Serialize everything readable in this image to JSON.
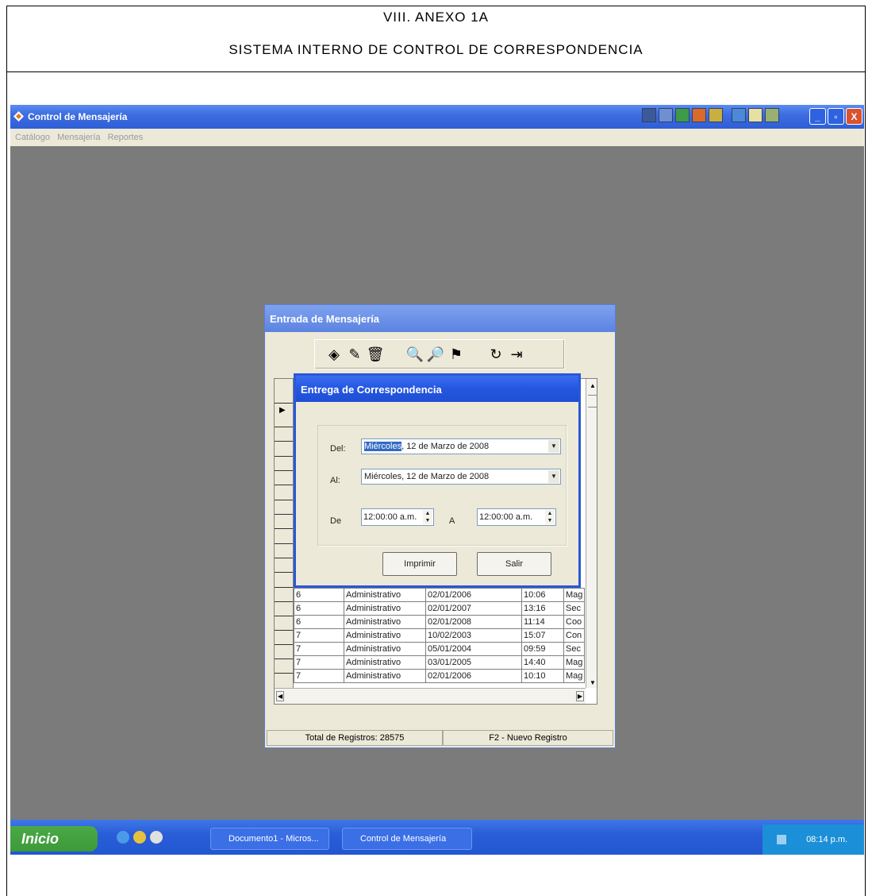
{
  "document": {
    "heading": "VIII. ANEXO 1A",
    "subheading": "SISTEMA INTERNO DE CONTROL DE CORRESPONDENCIA"
  },
  "app": {
    "title": "Control de Mensajería",
    "menu": [
      "Catálogo",
      "Mensajería",
      "Reportes"
    ],
    "window_buttons": {
      "minimize": "_",
      "maximize": "▫",
      "close": "X"
    }
  },
  "entrada": {
    "title": "Entrada de Mensajería",
    "rows": [
      [
        "6",
        "Administrativo",
        "02/01/2006",
        "10:06",
        "Mag"
      ],
      [
        "6",
        "Administrativo",
        "02/01/2007",
        "13:16",
        "Sec"
      ],
      [
        "6",
        "Administrativo",
        "02/01/2008",
        "11:14",
        "Coo"
      ],
      [
        "7",
        "Administrativo",
        "10/02/2003",
        "15:07",
        "Con"
      ],
      [
        "7",
        "Administrativo",
        "05/01/2004",
        "09:59",
        "Sec"
      ],
      [
        "7",
        "Administrativo",
        "03/01/2005",
        "14:40",
        "Mag"
      ],
      [
        "7",
        "Administrativo",
        "02/01/2006",
        "10:10",
        "Mag"
      ]
    ],
    "status_total": "Total de Registros: 28575",
    "status_hint": "F2 - Nuevo Registro"
  },
  "entrega": {
    "title": "Entrega de Correspondencia",
    "del_label": "Del:",
    "al_label": "Al:",
    "de_label": "De",
    "a_label": "A",
    "del_day": "Miércoles",
    "del_rest": ", 12 de    Marzo    de 2008",
    "al_value": "Miércoles, 12 de    Marzo    de 2008",
    "time_from": "12:00:00 a.m.",
    "time_to": "12:00:00 a.m.",
    "print_button": "Imprimir",
    "exit_button": "Salir"
  },
  "taskbar": {
    "start": "Inicio",
    "tasks": [
      "Documento1 - Micros...",
      "Control de Mensajería"
    ],
    "clock": "08:14 p.m."
  },
  "colors": {
    "titlebar": "#2f5ed6",
    "desktop": "#7b7b7b",
    "selection": "#316ac5",
    "start_green": "#3c9a3a"
  }
}
